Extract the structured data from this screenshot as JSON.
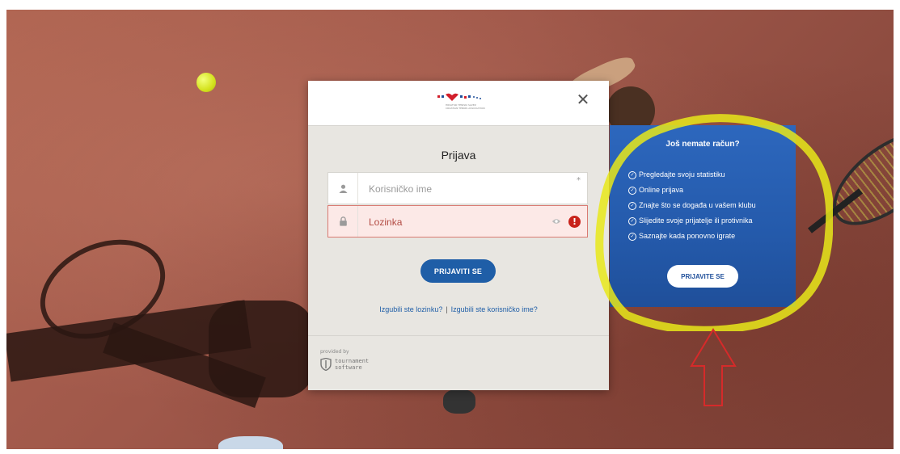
{
  "modal": {
    "title": "Prijava",
    "close_symbol": "✕",
    "logo_text_line1": "HRVATSKI TENISKI SAVEZ",
    "logo_text_line2": "CROATIAN TENNIS ASSOCIATION",
    "username_placeholder": "Korisničko ime",
    "username_required_mark": "*",
    "password_placeholder": "Lozinka",
    "password_error_symbol": "!",
    "login_button": "PRIJAVITI SE",
    "forgot_password": "Izgubili ste lozinku?",
    "separator": "|",
    "forgot_username": "Izgubili ste korisničko ime?",
    "provided_by": "provided by",
    "provider_line1": "tournament",
    "provider_line2": "software"
  },
  "side_panel": {
    "title": "Još nemate račun?",
    "items": [
      "Pregledajte svoju statistiku",
      "Online prijava",
      "Znajte što se događa u vašem klubu",
      "Slijedite svoje prijatelje ili protivnika",
      "Saznajte kada ponovno igrate"
    ],
    "register_button": "PRIJAVITE SE"
  },
  "icons": {
    "user": "user-icon",
    "lock": "lock-icon",
    "eye": "eye-icon",
    "error": "error-icon",
    "check": "check-circle-icon",
    "close": "close-icon"
  },
  "colors": {
    "primary_blue": "#1f5ea7",
    "panel_blue": "#245aab",
    "error_red": "#c8231b",
    "annotation_yellow": "#e8e81a",
    "annotation_red": "#d62a2a"
  }
}
